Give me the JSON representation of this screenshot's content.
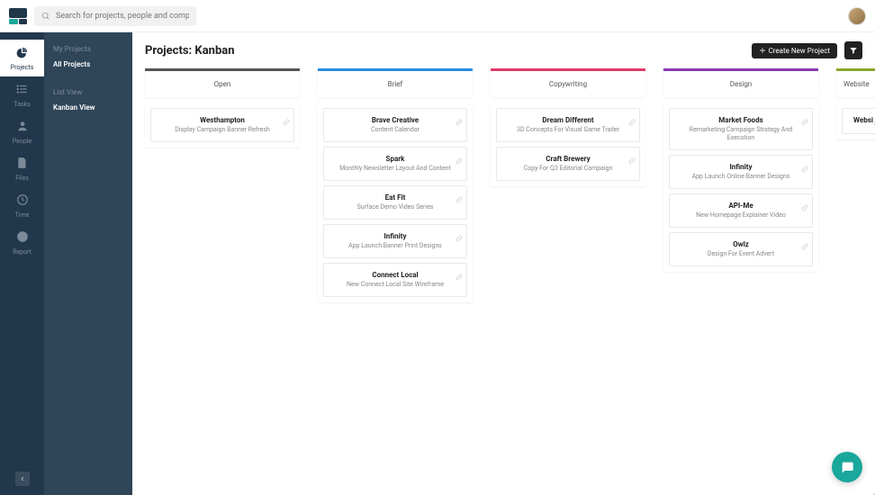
{
  "search": {
    "placeholder": "Search for projects, people and companies"
  },
  "nav": [
    {
      "id": "projects",
      "label": "Projects",
      "active": true
    },
    {
      "id": "tasks",
      "label": "Tasks",
      "active": false
    },
    {
      "id": "people",
      "label": "People",
      "active": false
    },
    {
      "id": "files",
      "label": "Files",
      "active": false
    },
    {
      "id": "time",
      "label": "Time",
      "active": false
    },
    {
      "id": "report",
      "label": "Report",
      "active": false
    }
  ],
  "sidebar": {
    "group1": [
      {
        "label": "My Projects",
        "active": false
      },
      {
        "label": "All Projects",
        "active": true
      }
    ],
    "group2": [
      {
        "label": "List View",
        "active": false
      },
      {
        "label": "Kanban View",
        "active": true
      }
    ]
  },
  "header": {
    "title": "Projects: Kanban",
    "create_label": "Create New Project"
  },
  "columns": [
    {
      "title": "Open",
      "color": "#555555",
      "cards": [
        {
          "title": "Westhampton",
          "sub": "Display Campaign Banner Refresh"
        }
      ]
    },
    {
      "title": "Brief",
      "color": "#2a8de0",
      "cards": [
        {
          "title": "Brave Creative",
          "sub": "Content Calendar"
        },
        {
          "title": "Spark",
          "sub": "Monthly Newsletter Layout And Content"
        },
        {
          "title": "Eat Fit",
          "sub": "Surface Demo Video Series"
        },
        {
          "title": "Infinity",
          "sub": "App Launch Banner Print Designs"
        },
        {
          "title": "Connect Local",
          "sub": "New Connect Local Site Wireframe"
        }
      ]
    },
    {
      "title": "Copywriting",
      "color": "#e03b6a",
      "cards": [
        {
          "title": "Dream Different",
          "sub": "3D Concepts For Visual Game Trailer"
        },
        {
          "title": "Craft Brewery",
          "sub": "Copy For Q3 Editorial Campaign"
        }
      ]
    },
    {
      "title": "Design",
      "color": "#8a3bb0",
      "cards": [
        {
          "title": "Market Foods",
          "sub": "Remarketing Campaign Strategy And Execution"
        },
        {
          "title": "Infinity",
          "sub": "App Launch Online Banner Designs"
        },
        {
          "title": "API-Me",
          "sub": "New Homepage Explainer Video"
        },
        {
          "title": "Owlz",
          "sub": "Design For Event Advert"
        }
      ]
    },
    {
      "title": "Website",
      "color": "#8aa82a",
      "peek": true,
      "cards": [
        {
          "title": "Websi",
          "sub": ""
        }
      ]
    }
  ]
}
